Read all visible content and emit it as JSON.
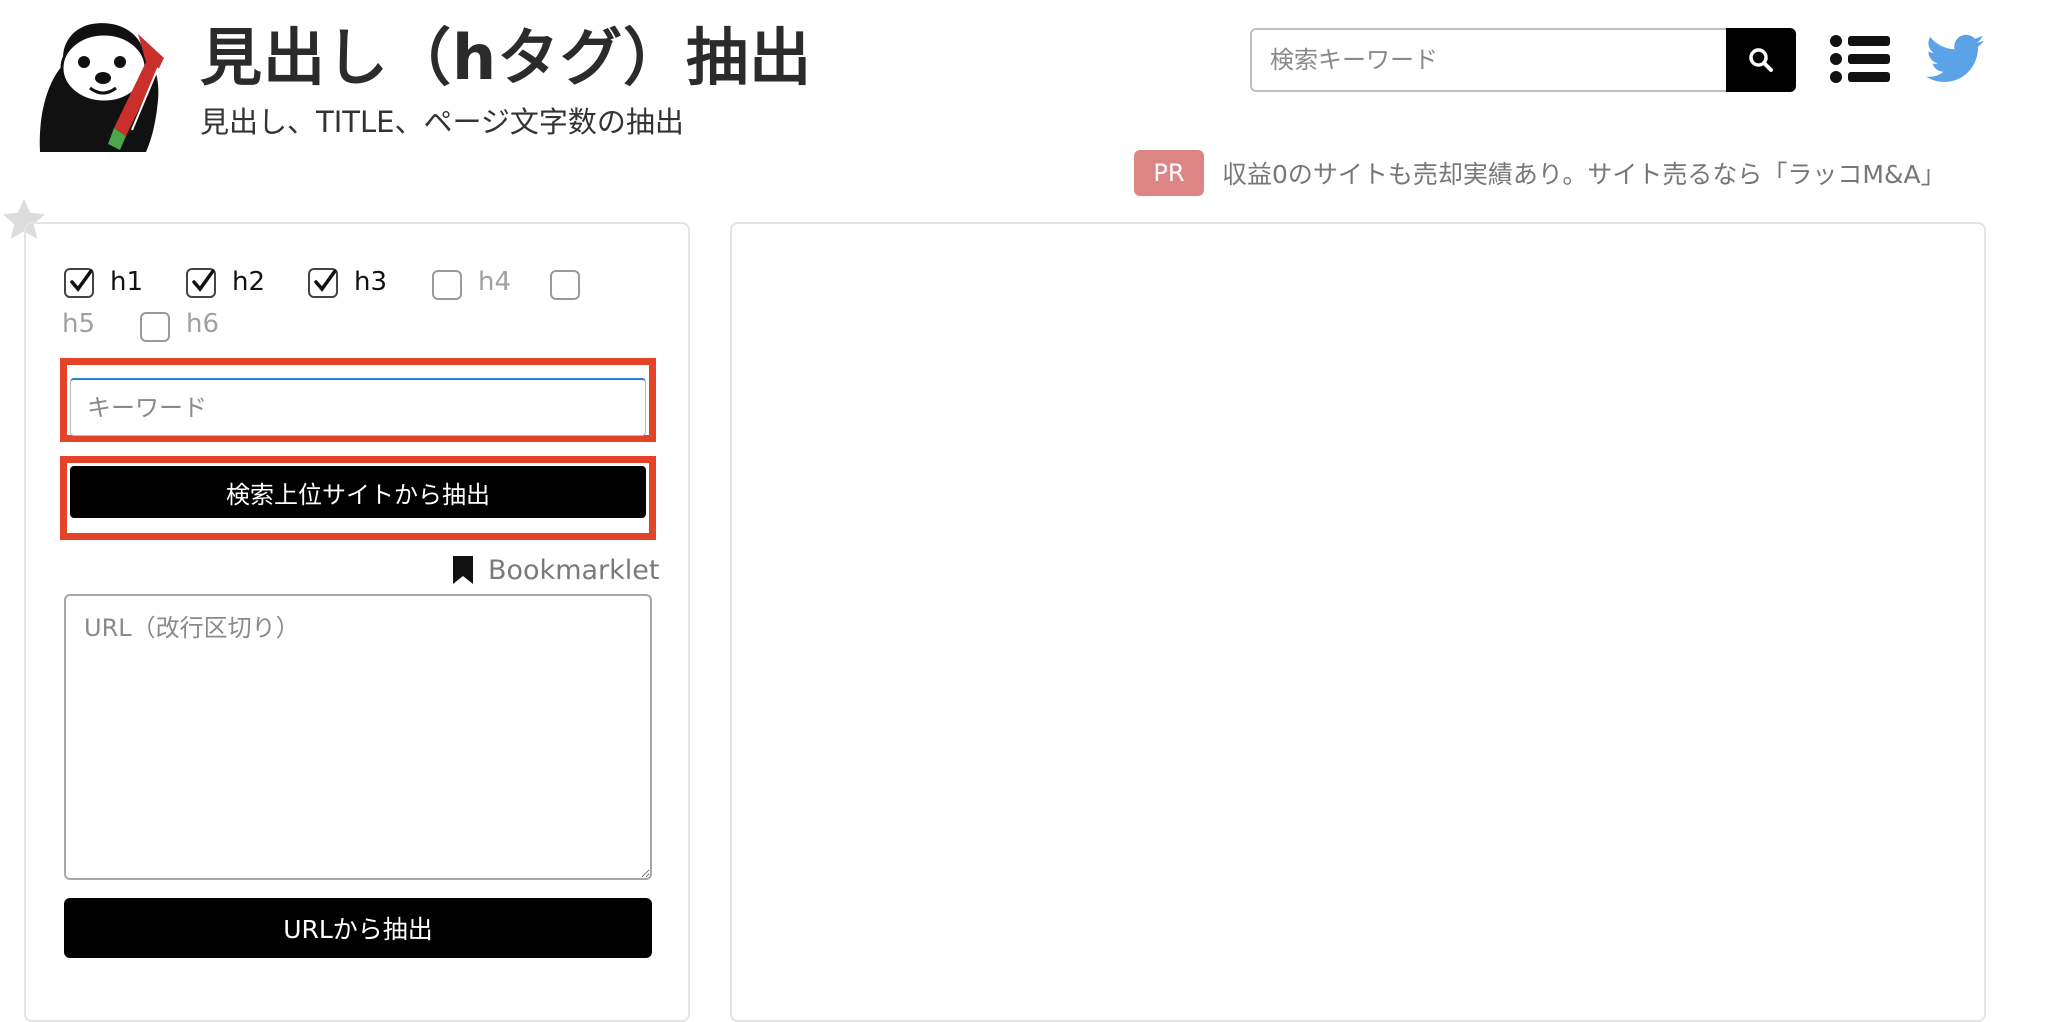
{
  "header": {
    "title": "見出し（hタグ）抽出",
    "subtitle": "見出し、TITLE、ページ文字数の抽出",
    "search_placeholder": "検索キーワード"
  },
  "pr": {
    "badge": "PR",
    "text": "収益0のサイトも売却実績あり。サイト売るなら「ラッコM&A」"
  },
  "headings": [
    {
      "label": "h1",
      "checked": true
    },
    {
      "label": "h2",
      "checked": true
    },
    {
      "label": "h3",
      "checked": true
    },
    {
      "label": "h4",
      "checked": false
    },
    {
      "label": "h5",
      "checked": false
    },
    {
      "label": "h6",
      "checked": false
    }
  ],
  "form": {
    "keyword_placeholder": "キーワード",
    "top_sites_button": "検索上位サイトから抽出",
    "bookmarklet_label": "Bookmarklet",
    "url_placeholder": "URL（改行区切り）",
    "url_button": "URLから抽出"
  },
  "colors": {
    "highlight": "#e54327",
    "pr_badge": "#dd8585",
    "twitter": "#5ba3e6"
  },
  "icons": [
    "otter-logo",
    "search-icon",
    "list-menu-icon",
    "twitter-icon",
    "star-icon",
    "bookmark-icon",
    "check-icon"
  ]
}
